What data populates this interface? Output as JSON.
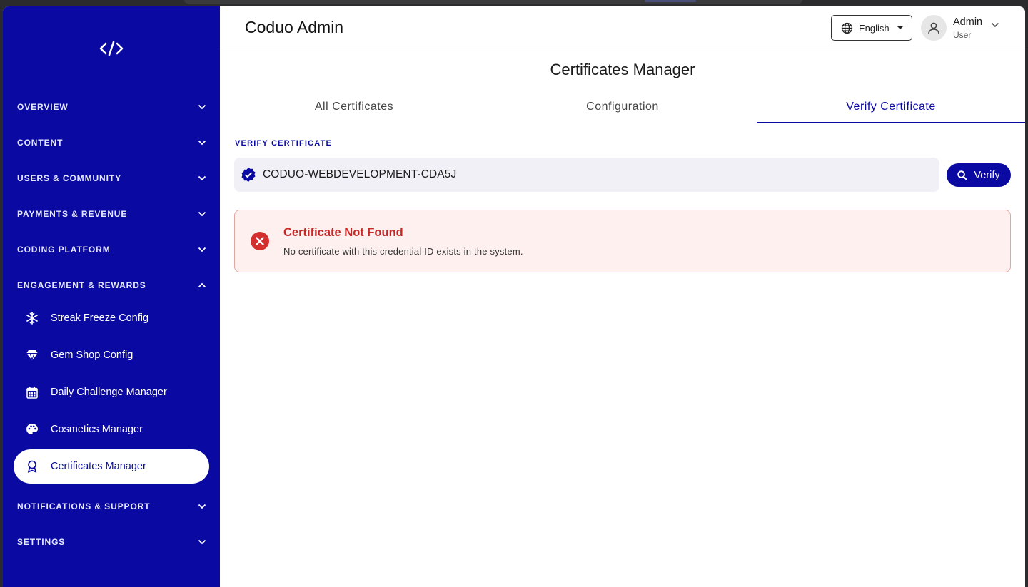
{
  "app": {
    "title": "Coduo Admin"
  },
  "header": {
    "language": "English",
    "user_name": "Admin",
    "user_role": "User"
  },
  "sidebar": {
    "sections": [
      {
        "label": "OVERVIEW",
        "expanded": false
      },
      {
        "label": "CONTENT",
        "expanded": false
      },
      {
        "label": "USERS & COMMUNITY",
        "expanded": false
      },
      {
        "label": "PAYMENTS & REVENUE",
        "expanded": false
      },
      {
        "label": "CODING PLATFORM",
        "expanded": false
      },
      {
        "label": "ENGAGEMENT & REWARDS",
        "expanded": true
      },
      {
        "label": "NOTIFICATIONS & SUPPORT",
        "expanded": false
      },
      {
        "label": "SETTINGS",
        "expanded": false
      }
    ],
    "engagement_items": [
      {
        "label": "Streak Freeze Config",
        "icon": "snowflake-icon"
      },
      {
        "label": "Gem Shop Config",
        "icon": "diamond-icon"
      },
      {
        "label": "Daily Challenge Manager",
        "icon": "calendar-icon"
      },
      {
        "label": "Cosmetics Manager",
        "icon": "palette-icon"
      },
      {
        "label": "Certificates Manager",
        "icon": "award-icon",
        "active": true
      }
    ]
  },
  "main": {
    "page_title": "Certificates Manager",
    "tabs": [
      {
        "label": "All Certificates"
      },
      {
        "label": "Configuration"
      },
      {
        "label": "Verify Certificate",
        "active": true
      }
    ],
    "verify": {
      "field_label": "VERIFY CERTIFICATE",
      "credential_value": "CODUO-WEBDEVELOPMENT-CDA5J",
      "button_label": "Verify"
    },
    "alert": {
      "title": "Certificate Not Found",
      "message": "No certificate with this credential ID exists in the system."
    }
  },
  "colors": {
    "brand": "#0a0aa3",
    "error": "#c62828",
    "error_bg": "#fdf0ef"
  }
}
